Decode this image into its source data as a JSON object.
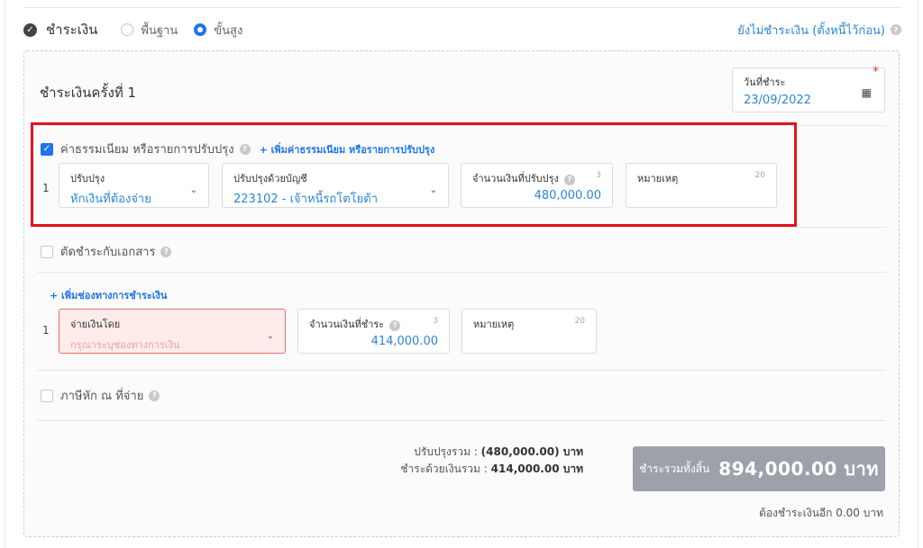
{
  "header": {
    "title": "ชำระเงิน",
    "mode_basic": "พื้นฐาน",
    "mode_advanced": "ขั้นสูง",
    "unpaid_link": "ยังไม่ชำระเงิน (ตั้งหนี้ไว้ก่อน)"
  },
  "installment": {
    "title": "ชำระเงินครั้งที่ 1",
    "date_label": "วันที่ชำระ",
    "date_value": "23/09/2022"
  },
  "adjust": {
    "checkbox_label": "ค่าธรรมเนียม หรือรายการปรับปรุง",
    "add_link": "+ เพิ่มค่าธรรมเนียม หรือรายการปรับปรุง",
    "row_num": "1",
    "type_label": "ปรับปรุง",
    "type_value": "หักเงินที่ต้องจ่าย",
    "account_label": "ปรับปรุงด้วยบัญชี",
    "account_value": "223102 - เจ้าหนี้รถโตโยต้า",
    "amount_label": "จำนวนเงินที่ปรับปรุง",
    "amount_count": "3",
    "amount_value": "480,000.00",
    "note_label": "หมายเหตุ",
    "note_count": "20"
  },
  "offset": {
    "checkbox_label": "ตัดชำระกับเอกสาร"
  },
  "payment": {
    "add_link": "+ เพิ่มช่องทางการชำระเงิน",
    "row_num": "1",
    "method_label": "จ่ายเงินโดย",
    "method_placeholder": "กรุณาระบุช่องทางการเงิน",
    "amount_label": "จำนวนเงินที่ชำระ",
    "amount_count": "3",
    "amount_value": "414,000.00",
    "note_label": "หมายเหตุ",
    "note_count": "20"
  },
  "withholding": {
    "checkbox_label": "ภาษีหัก ณ ที่จ่าย"
  },
  "summary": {
    "adjust_total_label": "ปรับปรุงรวม :",
    "adjust_total_value": "(480,000.00) บาท",
    "cash_total_label": "ชำระด้วยเงินรวม :",
    "cash_total_value": "414,000.00 บาท",
    "grand_label": "ชำระรวมทั้งสิ้น",
    "grand_value": "894,000.00 บาท",
    "remaining": "ต้องชำระเงินอีก 0.00 บาท"
  },
  "colors": {
    "accent": "#1e74e8",
    "highlight": "#e0141e",
    "total_button": "#9ea1aa"
  }
}
